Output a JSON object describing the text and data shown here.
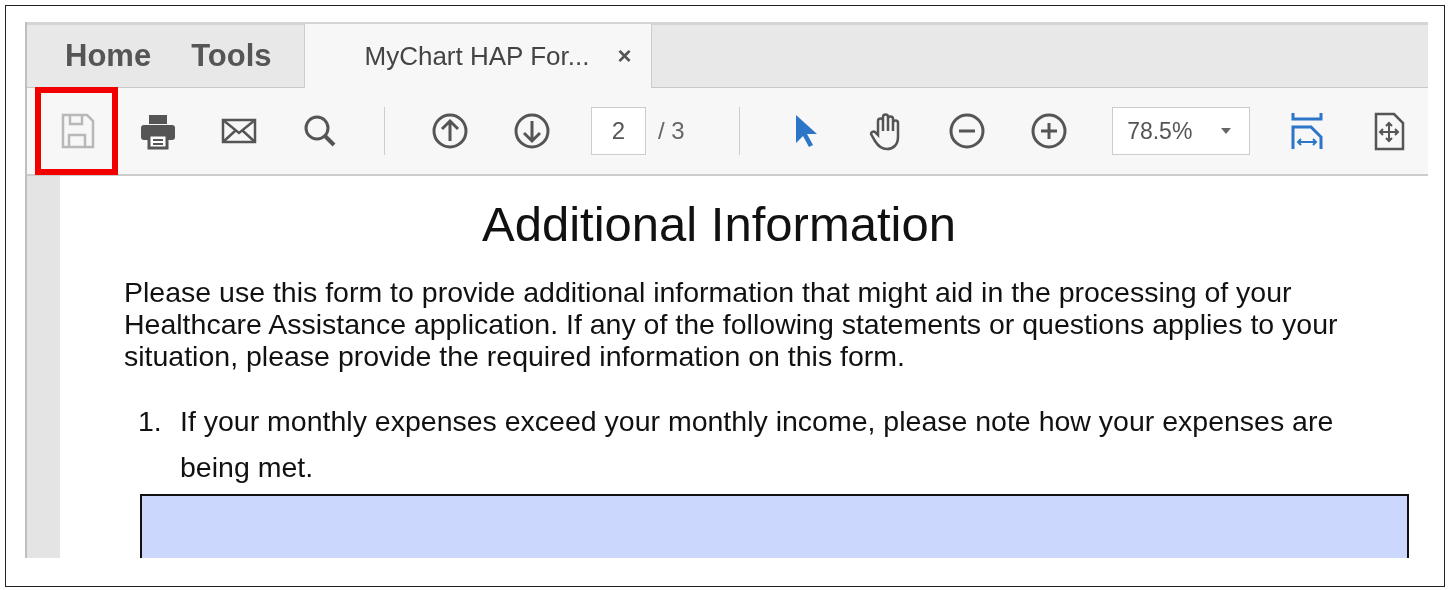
{
  "tabs": [
    {
      "label": "Home",
      "selected": false,
      "closable": false
    },
    {
      "label": "Tools",
      "selected": false,
      "closable": false
    },
    {
      "label": "MyChart HAP For...",
      "selected": true,
      "closable": true,
      "close_label": "×"
    }
  ],
  "toolbar": [
    {
      "kind": "save",
      "disabled": true,
      "highlighted": true,
      "selected": false
    },
    {
      "kind": "print",
      "disabled": false,
      "highlighted": false,
      "selected": false
    },
    {
      "kind": "email",
      "disabled": false,
      "highlighted": false,
      "selected": false
    },
    {
      "kind": "search",
      "disabled": false,
      "highlighted": false,
      "selected": false
    },
    {
      "kind": "separator"
    },
    {
      "kind": "page-up",
      "disabled": false,
      "highlighted": false,
      "selected": false
    },
    {
      "kind": "page-down",
      "disabled": false,
      "highlighted": false,
      "selected": false
    },
    {
      "kind": "page",
      "value": "2",
      "total": "/ 3"
    },
    {
      "kind": "separator"
    },
    {
      "kind": "select",
      "disabled": false,
      "highlighted": false,
      "selected": true
    },
    {
      "kind": "hand",
      "disabled": false,
      "highlighted": false,
      "selected": false
    },
    {
      "kind": "zoom-out",
      "disabled": false,
      "highlighted": false,
      "selected": false
    },
    {
      "kind": "zoom-in",
      "disabled": false,
      "highlighted": false,
      "selected": false
    },
    {
      "kind": "zoom",
      "value": "78.5%"
    },
    {
      "kind": "fit-width",
      "disabled": false,
      "highlighted": false,
      "selected": true
    },
    {
      "kind": "fit-page",
      "disabled": false,
      "highlighted": false,
      "selected": false
    }
  ],
  "document": {
    "title": "Additional Information",
    "intro": "Please use this form to provide additional information that might aid in the processing of your Healthcare Assistance application. If any of the following statements or questions applies to your situation, please provide the required information on this form.",
    "questions": [
      {
        "number": "1.",
        "text": "If your monthly expenses exceed your monthly income, please note how your expenses are being met."
      }
    ]
  }
}
